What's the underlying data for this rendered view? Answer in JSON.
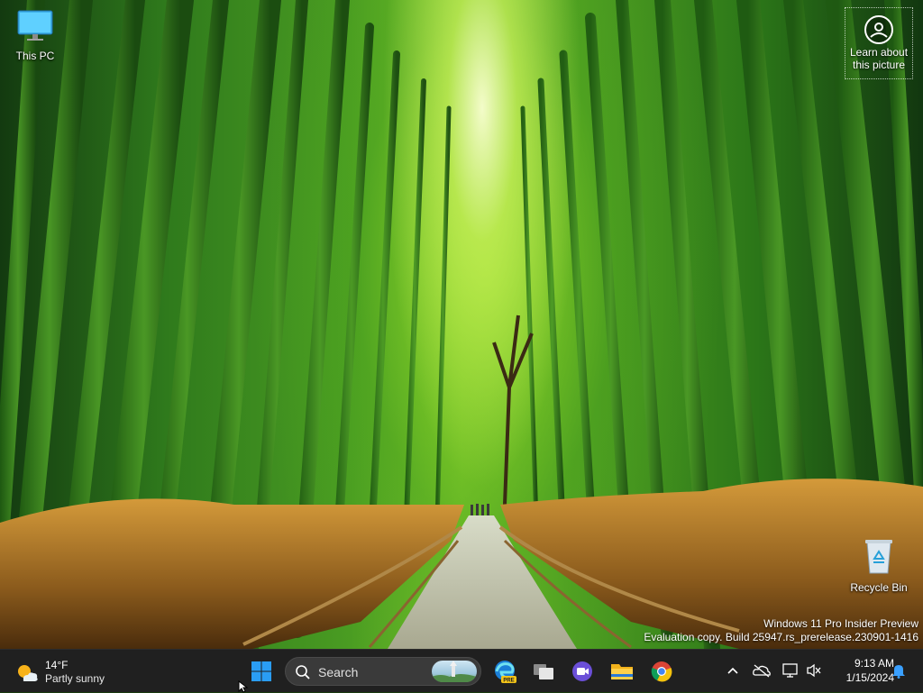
{
  "desktop": {
    "icons": [
      {
        "label": "This PC",
        "icon": "monitor-icon"
      },
      {
        "label": "Recycle Bin",
        "icon": "recycle-bin-icon"
      }
    ],
    "spotlight": {
      "label_line1": "Learn about",
      "label_line2": "this picture",
      "icon": "camera-circle-icon"
    },
    "watermark": {
      "line1": "Windows 11 Pro Insider Preview",
      "line2": "Evaluation copy. Build 25947.rs_prerelease.230901-1416"
    }
  },
  "taskbar": {
    "weather": {
      "temp": "14°F",
      "condition": "Partly sunny",
      "icon": "partly-sunny-icon"
    },
    "start_icon": "windows-logo-icon",
    "search": {
      "placeholder": "Search",
      "icon": "search-icon"
    },
    "apps": [
      {
        "name": "Microsoft Edge Preview",
        "icon": "edge-pre-icon",
        "badge": "PRE"
      },
      {
        "name": "Task View",
        "icon": "task-view-icon"
      },
      {
        "name": "Meet",
        "icon": "meet-icon"
      },
      {
        "name": "File Explorer",
        "icon": "folder-icon"
      },
      {
        "name": "Google Chrome",
        "icon": "chrome-icon"
      }
    ],
    "tray": {
      "icons": [
        "chevron-up-icon",
        "network-off-icon",
        "network-icon",
        "volume-mute-icon",
        "notification-bell-icon"
      ],
      "time": "9:13 AM",
      "date": "1/15/2024"
    }
  },
  "colors": {
    "taskbar_bg": "#202020",
    "start_blue": "#2a9df4",
    "notification_blue": "#3aa0ff"
  }
}
